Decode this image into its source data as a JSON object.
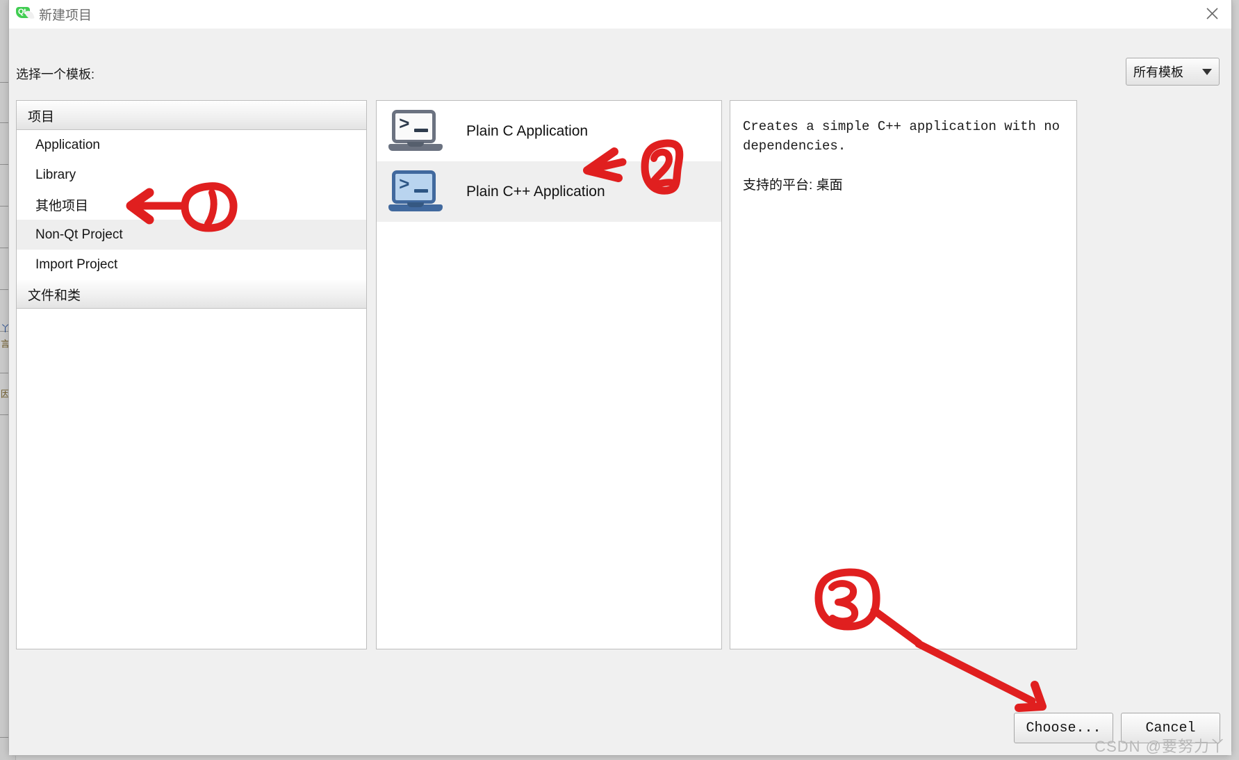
{
  "window": {
    "title": "新建项目",
    "logo_icon": "qt-logo-icon",
    "close_icon": "close-icon"
  },
  "header": {
    "prompt": "选择一个模板:",
    "filter": {
      "value": "所有模板",
      "caret_icon": "chevron-down-icon"
    }
  },
  "categories": {
    "groups": [
      {
        "header": "项目",
        "items": [
          {
            "label": "Application",
            "selected": false
          },
          {
            "label": "Library",
            "selected": false
          },
          {
            "label": "其他项目",
            "selected": false
          },
          {
            "label": "Non-Qt Project",
            "selected": true
          },
          {
            "label": "Import Project",
            "selected": false
          }
        ]
      },
      {
        "header": "文件和类",
        "items": []
      }
    ]
  },
  "templates": {
    "items": [
      {
        "label": "Plain C Application",
        "icon": "terminal-laptop-icon",
        "selected": false
      },
      {
        "label": "Plain C++ Application",
        "icon": "terminal-laptop-icon",
        "selected": true
      }
    ]
  },
  "description": {
    "text": "Creates a simple C++ application with no\ndependencies.",
    "platform_label": "支持的平台:",
    "platform_value": "桌面"
  },
  "footer": {
    "choose_label": "Choose...",
    "cancel_label": "Cancel"
  },
  "annotations": {
    "marker_1": "1",
    "marker_2": "2",
    "marker_3": "3",
    "color": "#e01f1f"
  },
  "watermark": "CSDN @要努力丫",
  "background_window": {
    "fragments": [
      "丫",
      "言",
      "因"
    ]
  }
}
